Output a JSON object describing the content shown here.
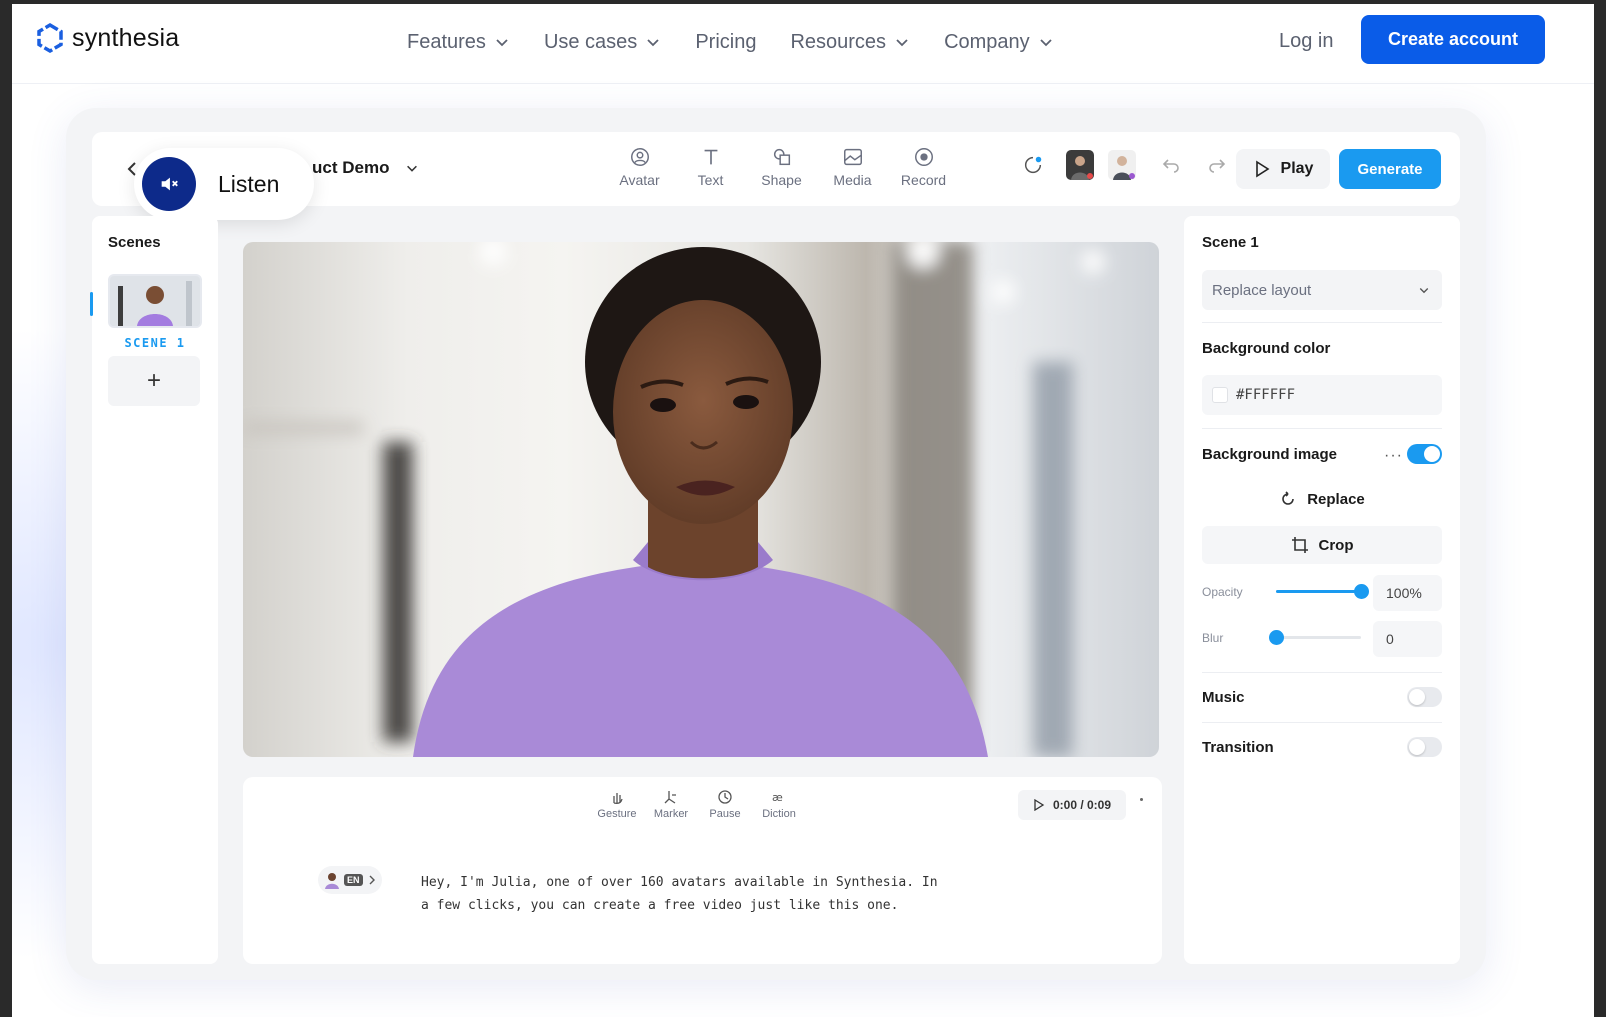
{
  "nav": {
    "logo": "synthesia",
    "links": [
      {
        "label": "Features",
        "dropdown": true
      },
      {
        "label": "Use cases",
        "dropdown": true
      },
      {
        "label": "Pricing",
        "dropdown": false
      },
      {
        "label": "Resources",
        "dropdown": true
      },
      {
        "label": "Company",
        "dropdown": true
      }
    ],
    "login": "Log in",
    "create_account": "Create account"
  },
  "editor": {
    "project_title": "uct Demo",
    "listen_label": "Listen",
    "tools": [
      {
        "label": "Avatar",
        "icon": "avatar-icon"
      },
      {
        "label": "Text",
        "icon": "text-icon"
      },
      {
        "label": "Shape",
        "icon": "shape-icon"
      },
      {
        "label": "Media",
        "icon": "media-icon"
      },
      {
        "label": "Record",
        "icon": "record-icon"
      }
    ],
    "play_label": "Play",
    "generate_label": "Generate",
    "colors": {
      "accent": "#1a9af0",
      "brand": "#0a5ce8",
      "listen": "#0d2a8a"
    }
  },
  "scenes": {
    "title": "Scenes",
    "items": [
      {
        "label": "SCENE 1"
      }
    ],
    "add_label": "+"
  },
  "script": {
    "tools": [
      {
        "label": "Gesture",
        "icon": "gesture-icon"
      },
      {
        "label": "Marker",
        "icon": "marker-icon"
      },
      {
        "label": "Pause",
        "icon": "pause-clock-icon"
      },
      {
        "label": "Diction",
        "icon": "diction-icon"
      }
    ],
    "time": "0:00 / 0:09",
    "language": "EN",
    "lines": [
      "Hey, I'm Julia, one of over 160 avatars available in Synthesia. In",
      "a few clicks, you can create a free video just like this one."
    ]
  },
  "properties": {
    "title": "Scene 1",
    "layout_placeholder": "Replace layout",
    "bg_color_label": "Background color",
    "bg_color_value": "#FFFFFF",
    "bg_image_label": "Background image",
    "bg_image_enabled": true,
    "replace_label": "Replace",
    "crop_label": "Crop",
    "opacity_label": "Opacity",
    "opacity_value": "100%",
    "opacity_level": 1.0,
    "blur_label": "Blur",
    "blur_value": "0",
    "blur_level": 0.0,
    "music_label": "Music",
    "music_enabled": false,
    "transition_label": "Transition",
    "transition_enabled": false
  }
}
